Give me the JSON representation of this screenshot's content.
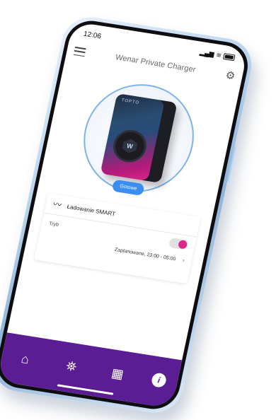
{
  "status": {
    "time": "12:06",
    "signal": "▂▄▆",
    "wifi": "≋"
  },
  "app": {
    "title": "Wenar Private Charger"
  },
  "charger": {
    "brand": "TOPTO",
    "badge": "W",
    "status": "Gotowe"
  },
  "smart_card": {
    "title": "Ładowanie SMART",
    "mode_label": "Tryb",
    "toggle_on": true,
    "schedule": "Zaplanowane, 23:00 - 05:00",
    "chevron": "›"
  },
  "nav": {
    "items": [
      {
        "name": "home-icon",
        "glyph": "⌂"
      },
      {
        "name": "map-pin-icon",
        "glyph": "⛯"
      },
      {
        "name": "qr-code-icon",
        "glyph": "▦"
      },
      {
        "name": "info-icon",
        "glyph": "i"
      }
    ]
  },
  "colors": {
    "accent_purple": "#5b1d93",
    "toggle_pink": "#d8288a",
    "status_blue": "#3b8ef0",
    "hero_ring": "#7fb2ea"
  }
}
